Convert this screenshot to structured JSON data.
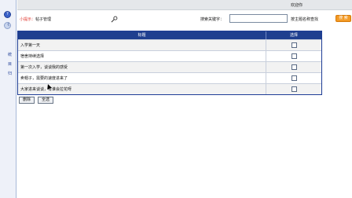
{
  "header": {
    "welcome": "欢迎你"
  },
  "hint": {
    "label": "小提示：",
    "value": "帖子管理"
  },
  "search": {
    "label": "搜索关键字：",
    "value": "",
    "placeholder": "",
    "hint": "按主题名称查找",
    "button": "搜 索"
  },
  "table": {
    "headers": [
      "标题",
      "选择"
    ],
    "rows": [
      {
        "title": "入学第一天"
      },
      {
        "title": "宿舍持续选择"
      },
      {
        "title": "第一次入学，谈谈我的感受"
      },
      {
        "title": "卖帽子，需要的速度进来了"
      },
      {
        "title": "大家进来谈谈，有谁会拉花呀"
      }
    ]
  },
  "actions": {
    "delete": "删除",
    "select_all": "全选"
  },
  "left_rail": {
    "labels": [
      "《",
      "统",
      "目",
      "归"
    ]
  },
  "colors": {
    "header_bg": "#1f3f8f",
    "accent_orange": "#f39a25",
    "hint_red": "#e0342b"
  }
}
